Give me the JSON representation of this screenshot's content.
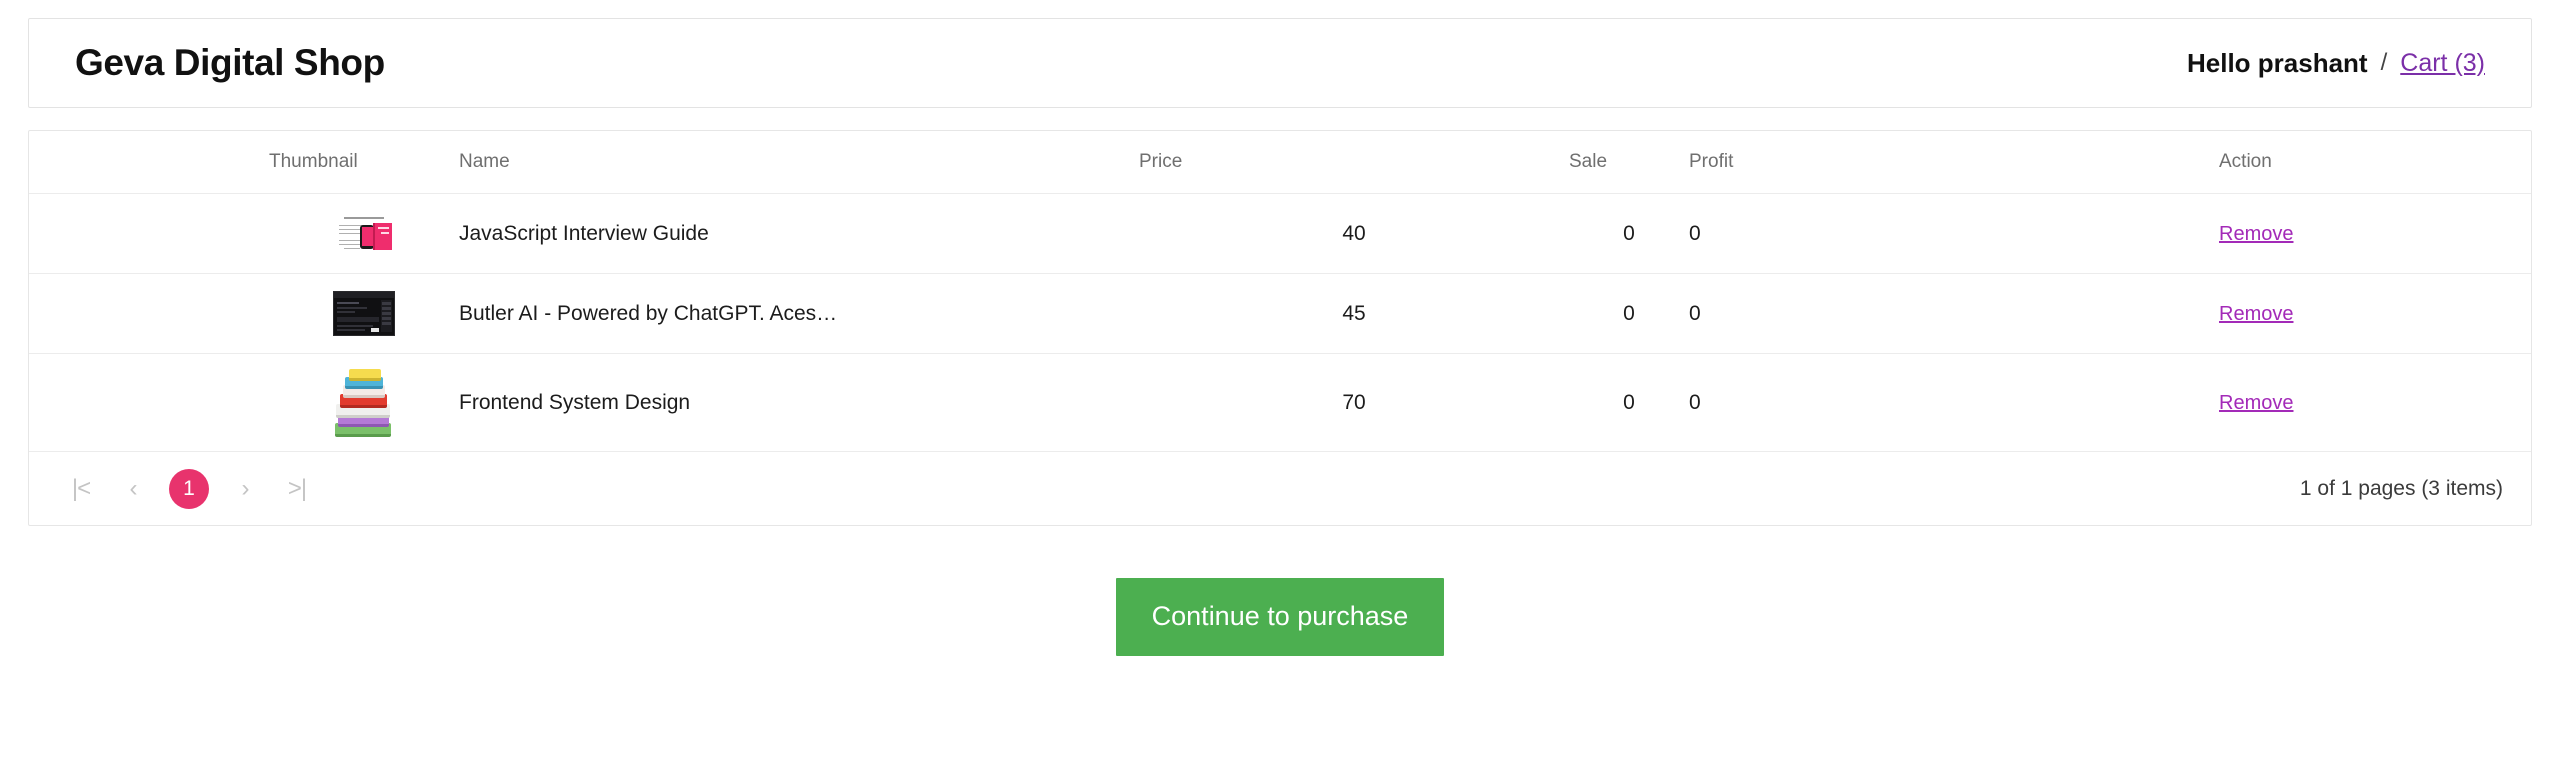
{
  "header": {
    "shop_title": "Geva Digital Shop",
    "greeting": "Hello prashant",
    "separator": "/",
    "cart_label": "Cart (3)"
  },
  "table": {
    "columns": {
      "thumbnail": "Thumbnail",
      "name": "Name",
      "price": "Price",
      "sale": "Sale",
      "profit": "Profit",
      "action": "Action"
    },
    "rows": [
      {
        "thumbnail_alt": "javascript-interview-guide-thumbnail",
        "name": "JavaScript Interview Guide",
        "price": "40",
        "sale": "0",
        "profit": "0",
        "action": "Remove"
      },
      {
        "thumbnail_alt": "butler-ai-thumbnail",
        "name": "Butler AI - Powered by ChatGPT. Aces…",
        "price": "45",
        "sale": "0",
        "profit": "0",
        "action": "Remove"
      },
      {
        "thumbnail_alt": "frontend-system-design-thumbnail",
        "name": "Frontend System Design",
        "price": "70",
        "sale": "0",
        "profit": "0",
        "action": "Remove"
      }
    ]
  },
  "pagination": {
    "first_label": "|<",
    "prev_label": "‹",
    "current_page": "1",
    "next_label": "›",
    "last_label": ">|",
    "status": "1 of 1 pages (3 items)"
  },
  "footer": {
    "purchase_label": "Continue to purchase"
  },
  "colors": {
    "accent_pink": "#e8336d",
    "link_purple": "#a32ab8",
    "cart_link_purple": "#7b2fa8",
    "button_green": "#4caf50",
    "border_gray": "#e6e6e6"
  }
}
